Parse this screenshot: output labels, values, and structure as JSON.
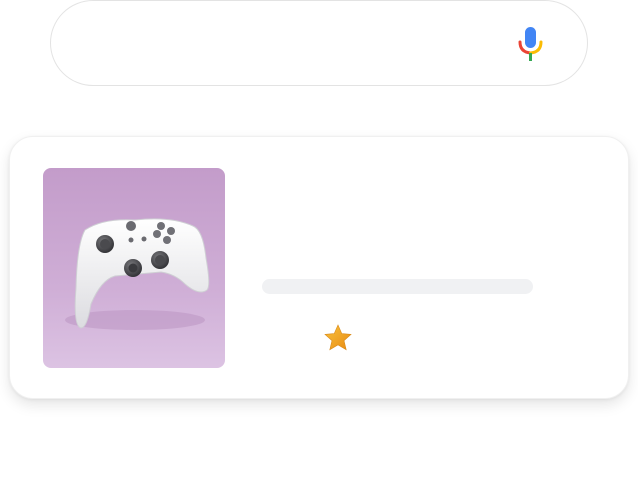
{
  "search": {
    "value": "",
    "placeholder": "",
    "mic_icon": "microphone-icon"
  },
  "result": {
    "image_icon": "game-controller-image",
    "title": "",
    "rating": {
      "icon": "star-icon",
      "color": "#f4a623"
    }
  },
  "colors": {
    "mic_blue": "#4285f4",
    "mic_red": "#ea4335",
    "mic_yellow": "#fbbc04",
    "mic_green": "#34a853",
    "image_background": "#c9a3d1"
  }
}
